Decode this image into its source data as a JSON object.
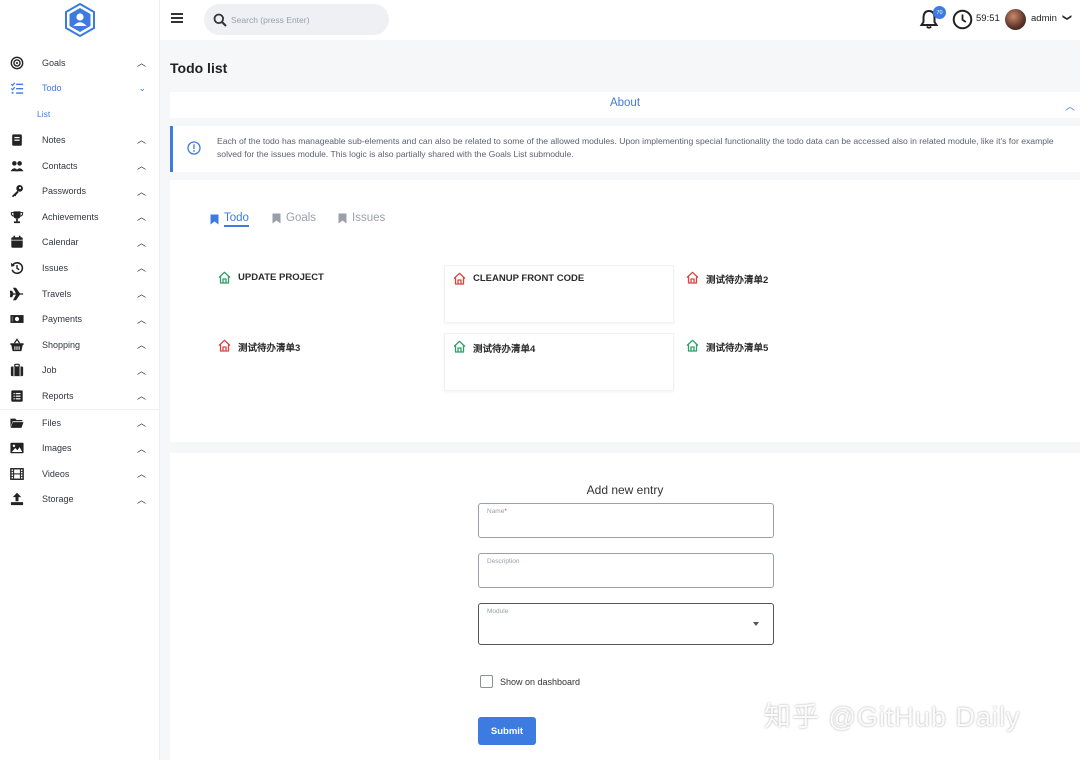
{
  "topbar": {
    "search_placeholder": "Search (press Enter)",
    "notification_count": "70",
    "timer": "59:51",
    "username": "admin",
    "user_chevron": "❯"
  },
  "sidebar": {
    "items": [
      {
        "label": "Goals",
        "icon": "target-icon",
        "chevron": "^"
      },
      {
        "label": "Todo",
        "icon": "checklist-icon",
        "chevron": "v"
      },
      {
        "label": "List",
        "icon": "",
        "chevron": ""
      },
      {
        "label": "Notes",
        "icon": "notebook-icon",
        "chevron": "^"
      },
      {
        "label": "Contacts",
        "icon": "users-icon",
        "chevron": "^"
      },
      {
        "label": "Passwords",
        "icon": "key-icon",
        "chevron": "^"
      },
      {
        "label": "Achievements",
        "icon": "trophy-icon",
        "chevron": "^"
      },
      {
        "label": "Calendar",
        "icon": "calendar-icon",
        "chevron": "^"
      },
      {
        "label": "Issues",
        "icon": "history-icon",
        "chevron": "^"
      },
      {
        "label": "Travels",
        "icon": "plane-icon",
        "chevron": "^"
      },
      {
        "label": "Payments",
        "icon": "money-icon",
        "chevron": "^"
      },
      {
        "label": "Shopping",
        "icon": "basket-icon",
        "chevron": "^"
      },
      {
        "label": "Job",
        "icon": "briefcase-icon",
        "chevron": "^"
      },
      {
        "label": "Reports",
        "icon": "report-icon",
        "chevron": "^"
      },
      {
        "label": "Files",
        "icon": "folder-icon",
        "chevron": "^"
      },
      {
        "label": "Images",
        "icon": "image-icon",
        "chevron": "^"
      },
      {
        "label": "Videos",
        "icon": "film-icon",
        "chevron": "^"
      },
      {
        "label": "Storage",
        "icon": "upload-icon",
        "chevron": "^"
      }
    ]
  },
  "main": {
    "title": "Todo list",
    "about": {
      "title": "About",
      "text": "Each of the todo has manageable sub-elements and can also be related to some of the allowed modules. Upon implementing special functionality the todo data can be accessed also in related module, like it's for example solved for the issues module. This logic is also partially shared with the Goals List submodule."
    },
    "tabs": [
      {
        "label": "Todo",
        "active": true
      },
      {
        "label": "Goals",
        "active": false
      },
      {
        "label": "Issues",
        "active": false
      }
    ],
    "todos": [
      {
        "label": "UPDATE PROJECT",
        "color": "#2e9e6a"
      },
      {
        "label": "CLEANUP FRONT CODE",
        "color": "#d9453c"
      },
      {
        "label": "测试待办清单2",
        "color": "#d9453c"
      },
      {
        "label": "测试待办清单3",
        "color": "#d9453c"
      },
      {
        "label": "测试待办清单4",
        "color": "#2e9e6a"
      },
      {
        "label": "测试待办清单5",
        "color": "#2e9e6a"
      }
    ],
    "form": {
      "title": "Add new entry",
      "name_label": "Name",
      "name_required": "*",
      "description_label": "Description",
      "module_label": "Module",
      "checkbox_label": "Show on dashboard",
      "submit_label": "Submit"
    }
  },
  "colors": {
    "accent": "#3d7be0",
    "status_green": "#2e9e6a",
    "status_red": "#d9453c"
  },
  "watermark": "知乎 @GitHub Daily"
}
